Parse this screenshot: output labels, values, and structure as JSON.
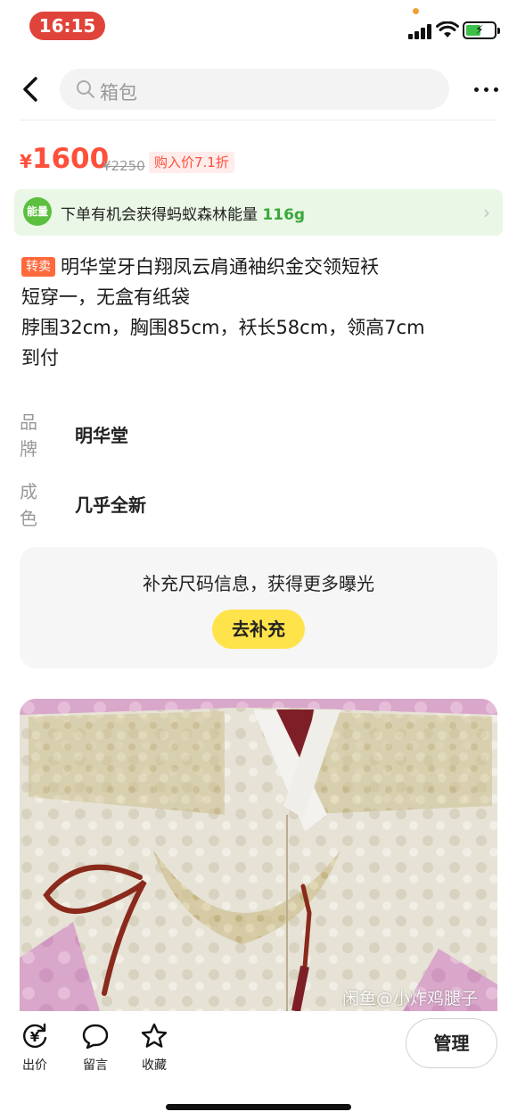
{
  "status_bar": {
    "time": "16:15"
  },
  "search": {
    "placeholder": "箱包"
  },
  "price": {
    "symbol": "¥",
    "value": "1600",
    "original": "¥2250",
    "tag": "购入价7.1折"
  },
  "energy": {
    "badge": "能量",
    "text": "下单有机会获得蚂蚁森林能量 ",
    "value": "116g"
  },
  "listing": {
    "resell_tag": "转卖",
    "title": "明华堂牙白翔凤云肩通袖织金交领短袄",
    "lines": [
      "短穿一，无盒有纸袋",
      "脖围32cm，胸围85cm，袄长58cm，领高7cm",
      "到付"
    ]
  },
  "attributes": [
    {
      "key": "品牌",
      "value": "明华堂"
    },
    {
      "key": "成色",
      "value": "几乎全新"
    }
  ],
  "supplement": {
    "text": "补充尺码信息，获得更多曝光",
    "button": "去补充"
  },
  "photo": {
    "watermark": "闲鱼@小炸鸡腿子"
  },
  "bottom_bar": {
    "bid": "出价",
    "message": "留言",
    "favorite": "收藏",
    "manage": "管理"
  },
  "colors": {
    "price_red": "#ff4f3a",
    "energy_green": "#3aa83a",
    "button_yellow": "#ffe34a",
    "time_pill": "#e0433a"
  }
}
